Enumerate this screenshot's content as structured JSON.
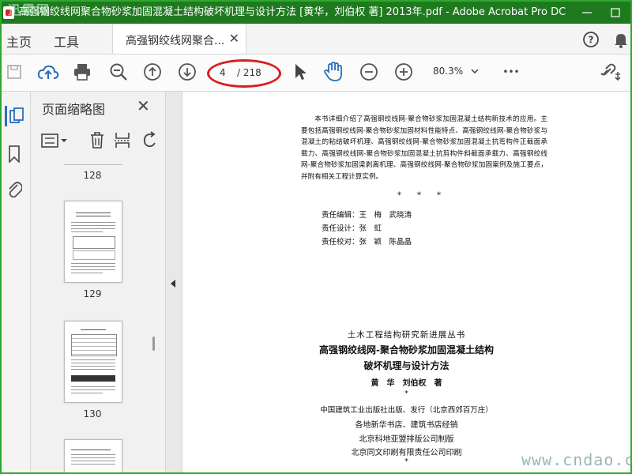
{
  "window": {
    "title": "高强钢绞线网聚合物砂浆加固混凝土结构破坏机理与设计方法 [黄华，刘伯权 著] 2013年.pdf - Adobe Acrobat Pro DC",
    "watermark": "迅雷网"
  },
  "tabs": {
    "home": "主页",
    "tools": "工具",
    "document": "高强钢绞线网聚合..."
  },
  "toolbar": {
    "page_current": "4",
    "page_total": "/ 218",
    "zoom": "80.3%",
    "more": "•••"
  },
  "thumbnail_panel": {
    "title": "页面缩略图",
    "pages": [
      {
        "label": "128"
      },
      {
        "label": "129"
      },
      {
        "label": "130"
      }
    ]
  },
  "document": {
    "intro": "本书详细介绍了高强钢绞线网-聚合物砂浆加固混凝土结构新技术的应用。主要包括高强钢绞线网-聚合物砂浆加固材料性能特点、高强钢绞线网-聚合物砂浆与混凝土的粘结破坏机理、高强钢绞线网-聚合物砂浆加固混凝土抗弯构件正截面承载力、高强钢绞线网-聚合物砂浆加固混凝土抗剪构件斜截面承载力、高强钢绞线网-聚合物砂浆加固梁剥离机理、高强钢绞线网-聚合物砂浆加固案例及施工要点，并附有相关工程计算实例。",
    "separator": "*　　*　　*",
    "credits": [
      {
        "role": "责任编辑：",
        "names": "王　梅　武晓涛"
      },
      {
        "role": "责任设计：",
        "names": "张　虹"
      },
      {
        "role": "责任校对：",
        "names": "张　颖　陈晶晶"
      }
    ],
    "series": "土木工程结构研究新进展丛书",
    "book_title_1": "高强钢绞线网-聚合物砂浆加固混凝土结构",
    "book_title_2": "破坏机理与设计方法",
    "authors": "黄　华　刘伯权　著",
    "star": "*",
    "publisher": "中国建筑工业出版社出版、发行（北京西郊百万庄）",
    "distributor": "各地新华书店、建筑书店经销",
    "typesetter": "北京科地亚盟排版公司制版",
    "printer": "北京同文印刷有限责任公司印刷",
    "star2": "*"
  },
  "site_watermark": "www.cndao.com",
  "colors": {
    "titlebar": "#1f7a1f",
    "accent_blue": "#2a6ebb",
    "annotation_red": "#d62020"
  }
}
